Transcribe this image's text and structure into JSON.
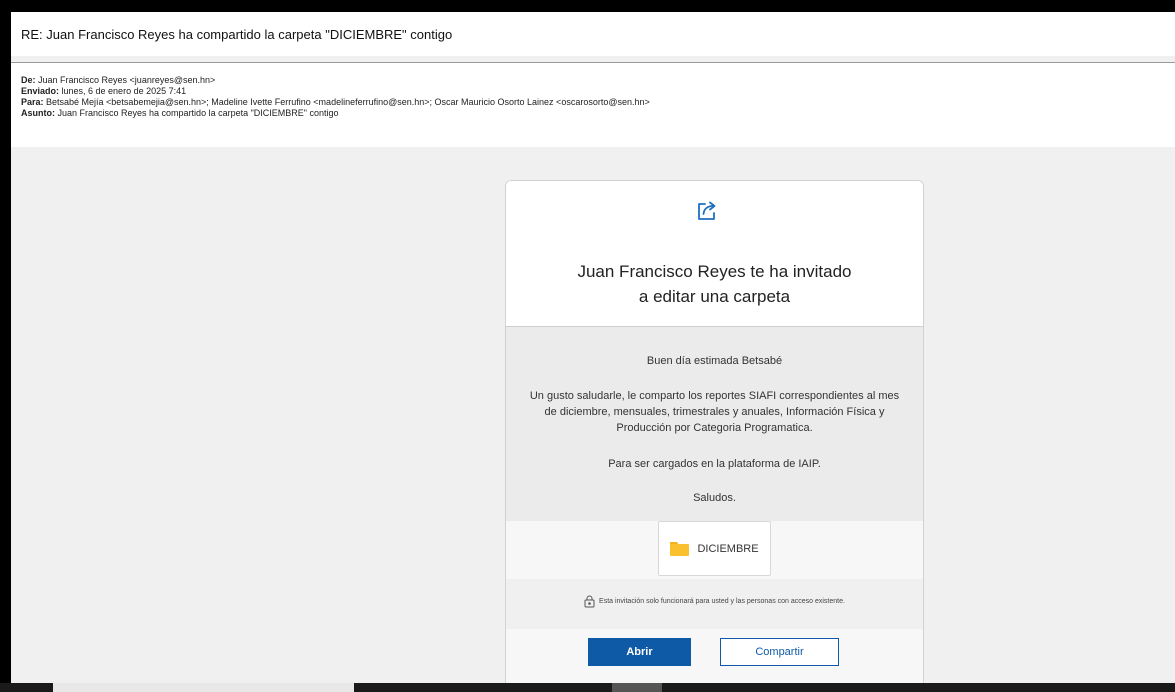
{
  "email": {
    "subject": "RE: Juan Francisco Reyes ha compartido la carpeta \"DICIEMBRE\" contigo",
    "headers": {
      "from_label": "De:",
      "from_value": " Juan Francisco Reyes <juanreyes@sen.hn>",
      "sent_label": "Enviado:",
      "sent_value": " lunes, 6 de enero de 2025 7:41",
      "to_label": "Para:",
      "to_value": " Betsabé Mejía <betsabemejia@sen.hn>; Madeline Ivette Ferrufino <madelineferrufino@sen.hn>; Oscar Mauricio Osorto Lainez <oscarosorto@sen.hn>",
      "subject_label": "Asunto:",
      "subject_value": " Juan Francisco Reyes ha compartido la carpeta \"DICIEMBRE\" contigo"
    }
  },
  "card": {
    "title_line1": "Juan Francisco Reyes te ha invitado",
    "title_line2": "a editar una carpeta",
    "greeting": "Buen día estimada Betsabé",
    "body_line1": "Un gusto saludarle, le comparto los reportes SIAFI correspondientes al mes",
    "body_line2": "de diciembre, mensuales, trimestrales y anuales, Información Física y",
    "body_line3": "Producción por Categoria Programatica.",
    "upload_note": "Para ser cargados en la plataforma de IAIP.",
    "closing": "Saludos.",
    "folder_name": "DICIEMBRE",
    "notice": "Esta invitación solo funcionará para usted y las personas con acceso existente.",
    "open_button": "Abrir",
    "share_button": "Compartir"
  },
  "icons": {
    "share": "share-arrow-icon",
    "folder": "folder-icon",
    "lock": "lock-icon"
  },
  "colors": {
    "accent": "#0f5aa6",
    "folder": "#fbc02d"
  }
}
